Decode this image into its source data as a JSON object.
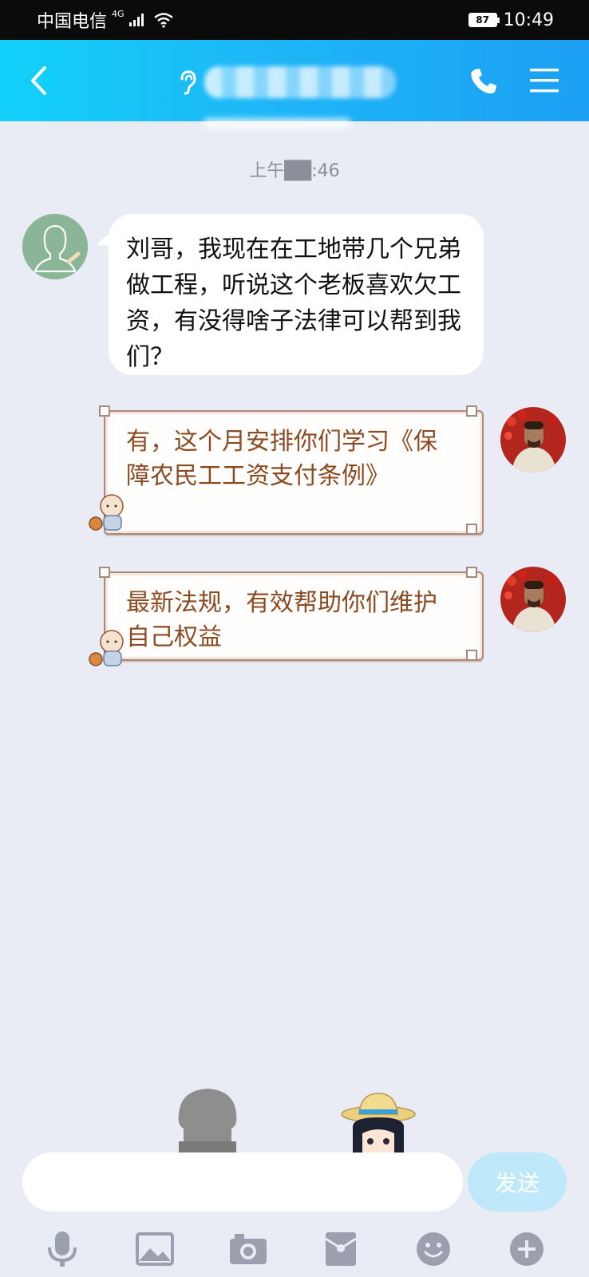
{
  "status_bar": {
    "carrier": "中国电信",
    "network": "4G",
    "battery": "87",
    "time": "10:49"
  },
  "header": {
    "back_icon": "chevron-left-icon",
    "contact_name": "██████",
    "phone_icon": "phone-icon",
    "menu_icon": "hamburger-menu-icon"
  },
  "chat": {
    "timestamp": "上午██:46",
    "messages": [
      {
        "direction": "incoming",
        "text": "刘哥，我现在在工地带几个兄弟做工程，听说这个老板喜欢欠工资，有没得啥子法律可以帮到我们？"
      },
      {
        "direction": "outgoing",
        "text": "有，这个月安排你们学习《保障农民工工资支付条例》"
      },
      {
        "direction": "outgoing",
        "text": "最新法规，有效帮助你们维护自己权益"
      }
    ]
  },
  "input": {
    "placeholder": "",
    "send_label": "发送"
  },
  "toolbar": {
    "items": [
      "microphone-icon",
      "image-icon",
      "camera-icon",
      "red-packet-icon",
      "emoji-icon",
      "plus-icon"
    ]
  },
  "colors": {
    "header_start": "#12d1f8",
    "header_end": "#1ba0f3",
    "chat_bg": "#e9ecf4",
    "outgoing_text": "#8a4a22",
    "send_bg": "#bfe8fb",
    "icon_gray": "#9aa0ad"
  }
}
